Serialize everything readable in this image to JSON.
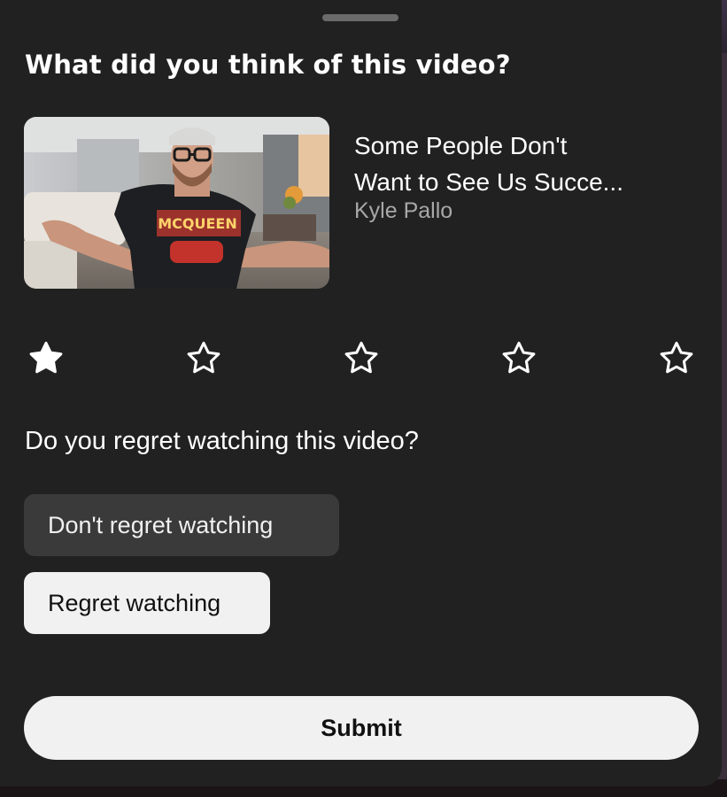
{
  "survey": {
    "title": "What did you think of this video?",
    "video": {
      "title_line1": "Some People Don't",
      "title_line2": "Want to See Us Succe...",
      "channel": "Kyle Pallo",
      "shirt_text": "MCQUEEN"
    },
    "rating": {
      "max": 5,
      "selected": 1,
      "icon": "star-icon"
    },
    "question": "Do you regret watching this video?",
    "options": [
      {
        "label": "Don't regret watching"
      },
      {
        "label": "Regret watching"
      }
    ],
    "submit_label": "Submit"
  },
  "colors": {
    "sheet_bg": "#212121",
    "text_primary": "#ffffff",
    "text_secondary": "#a8a8a8",
    "chip_dark": "#3a3a3a",
    "chip_light": "#f1f1f1"
  }
}
